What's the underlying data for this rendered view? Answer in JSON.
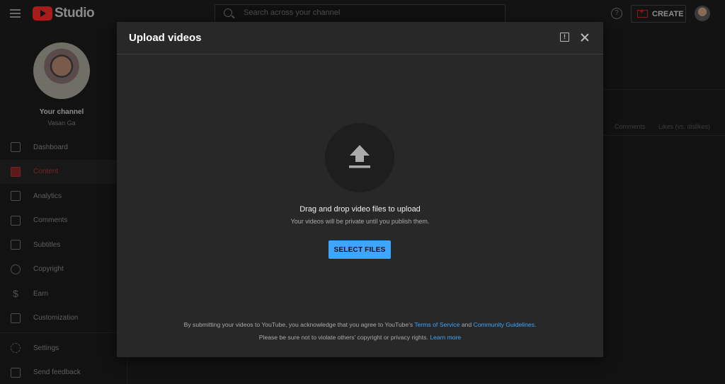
{
  "app": {
    "logo_text": "Studio"
  },
  "search": {
    "placeholder": "Search across your channel"
  },
  "header": {
    "help_icon": "help-icon",
    "create_label": "CREATE"
  },
  "channel": {
    "title": "Your channel",
    "name": "Vasan Ga"
  },
  "sidebar": {
    "items": [
      {
        "label": "Dashboard",
        "icon": "dashboard-icon"
      },
      {
        "label": "Content",
        "icon": "content-icon",
        "active": true
      },
      {
        "label": "Analytics",
        "icon": "analytics-icon"
      },
      {
        "label": "Comments",
        "icon": "comments-icon"
      },
      {
        "label": "Subtitles",
        "icon": "subtitles-icon"
      },
      {
        "label": "Copyright",
        "icon": "copyright-icon"
      },
      {
        "label": "Earn",
        "icon": "dollar-icon"
      },
      {
        "label": "Customization",
        "icon": "magic-wand-icon"
      },
      {
        "label": "Settings",
        "icon": "gear-icon"
      },
      {
        "label": "Send feedback",
        "icon": "feedback-icon"
      }
    ]
  },
  "background_table": {
    "columns": [
      "Comments",
      "Likes (vs. dislikes)"
    ]
  },
  "modal": {
    "title": "Upload videos",
    "drop_title": "Drag and drop video files to upload",
    "drop_subtitle": "Your videos will be private until you publish them.",
    "select_button": "SELECT FILES",
    "legal_line1_prefix": "By submitting your videos to YouTube, you acknowledge that you agree to YouTube's",
    "terms_link": "Terms of Service",
    "and_text": "and",
    "guidelines_link": "Community Guidelines",
    "legal_line2_prefix": "Please be sure not to violate others' copyright or privacy rights.",
    "learn_more_link": "Learn more"
  },
  "colors": {
    "accent": "#3ea6ff",
    "brand_red": "#ff0000",
    "modal_bg": "#282828"
  }
}
